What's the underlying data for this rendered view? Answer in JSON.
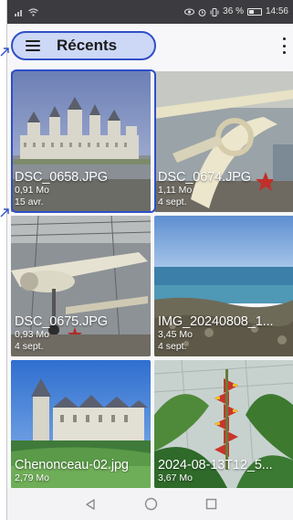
{
  "status_bar": {
    "battery_percent": "36 %",
    "time": "14:56"
  },
  "app_bar": {
    "title": "Récents"
  },
  "files": [
    {
      "name": "DSC_0658.JPG",
      "size": "0,91 Mo",
      "date": "15 avr."
    },
    {
      "name": "DSC_0674.JPG",
      "size": "1,11 Mo",
      "date": "4 sept."
    },
    {
      "name": "DSC_0675.JPG",
      "size": "0,93 Mo",
      "date": "4 sept."
    },
    {
      "name": "IMG_20240808_1...",
      "size": "3,45 Mo",
      "date": "4 sept."
    },
    {
      "name": "Chenonceau-02.jpg",
      "size": "2,79 Mo",
      "date": ""
    },
    {
      "name": "2024-08-13T12_5...",
      "size": "3,67 Mo",
      "date": ""
    }
  ],
  "colors": {
    "accent": "#2f4fc7",
    "accent_fill": "#cdd7f6",
    "status_bar": "#3c3c40"
  },
  "icons": {
    "menu": "hamburger-icon",
    "more": "more-vert-icon",
    "back": "back-triangle-icon",
    "home": "home-circle-icon",
    "recents": "recents-square-icon"
  }
}
